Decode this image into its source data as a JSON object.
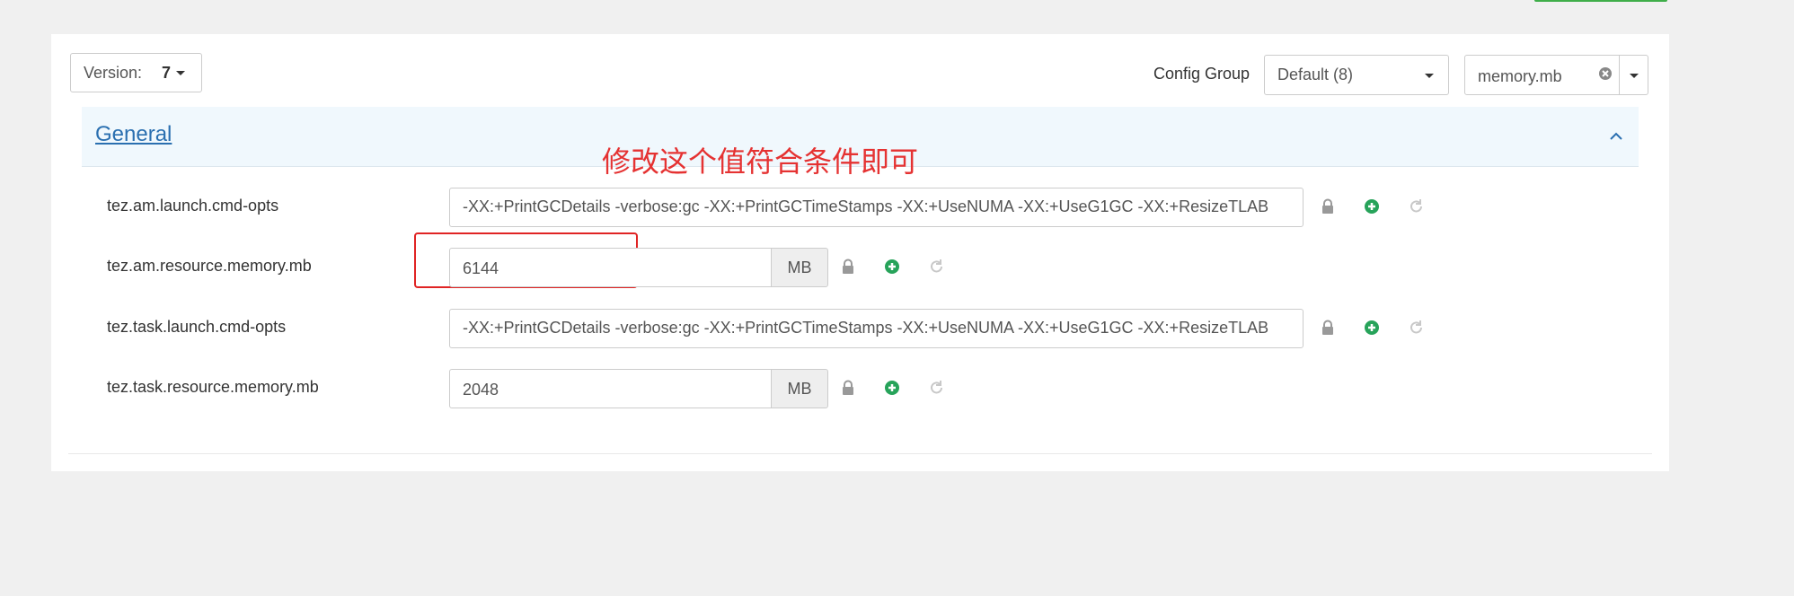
{
  "toolbar": {
    "version_label": "Version:",
    "version_value": "7",
    "config_group_label": "Config Group",
    "config_group_value": "Default (8)",
    "filter_value": "memory.mb"
  },
  "section": {
    "title": "General"
  },
  "annotation": {
    "text": "修改这个值符合条件即可"
  },
  "properties": [
    {
      "name": "tez.am.launch.cmd-opts",
      "value": "-XX:+PrintGCDetails -verbose:gc -XX:+PrintGCTimeStamps -XX:+UseNUMA -XX:+UseG1GC -XX:+ResizeTLAB"
    },
    {
      "name": "tez.am.resource.memory.mb",
      "value": "6144",
      "unit": "MB"
    },
    {
      "name": "tez.task.launch.cmd-opts",
      "value": "-XX:+PrintGCDetails -verbose:gc -XX:+PrintGCTimeStamps -XX:+UseNUMA -XX:+UseG1GC -XX:+ResizeTLAB"
    },
    {
      "name": "tez.task.resource.memory.mb",
      "value": "2048",
      "unit": "MB"
    }
  ],
  "colors": {
    "accent_green": "#27a35a",
    "link_blue": "#2a6fb0",
    "annotation_red": "#e53232"
  },
  "icons": [
    "lock-icon",
    "plus-circle-icon",
    "undo-icon",
    "clear-icon",
    "chevron-up-icon",
    "caret-down-icon"
  ]
}
